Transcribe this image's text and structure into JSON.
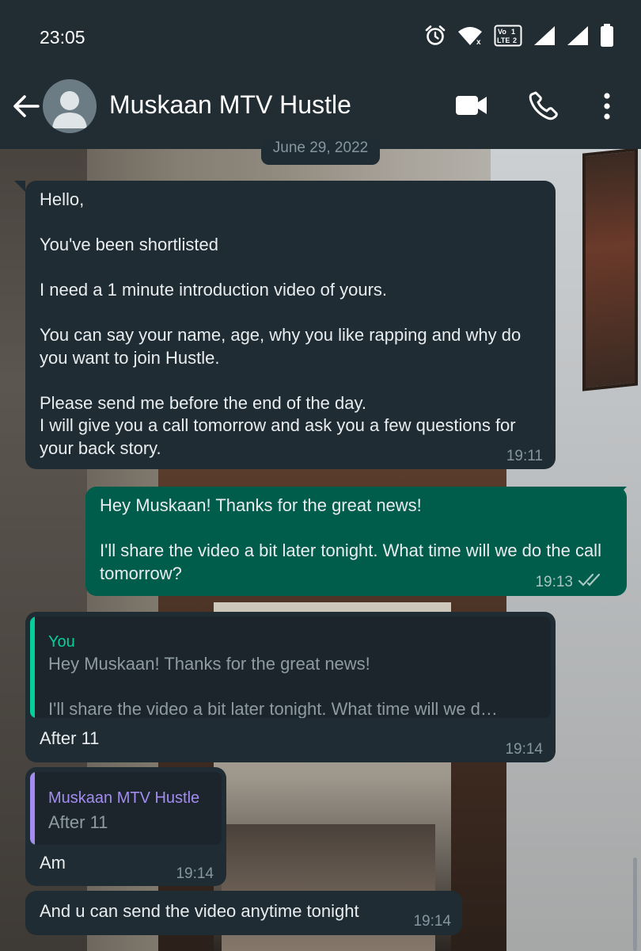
{
  "status_bar": {
    "time": "23:05",
    "icons": [
      "alarm-icon",
      "wifi-icon",
      "volte-lte-icon",
      "signal-1-icon",
      "signal-2-icon",
      "battery-icon"
    ],
    "volte_label_1": "Vo",
    "volte_label_2": "LTE"
  },
  "header": {
    "contact_name": "Muskaan MTV Hustle",
    "icons": [
      "back-arrow-icon",
      "avatar-placeholder-icon",
      "video-call-icon",
      "voice-call-icon",
      "more-vert-icon"
    ]
  },
  "date_chip": "June 29, 2022",
  "messages": [
    {
      "direction": "incoming",
      "text": "Hello,\n\nYou've been shortlisted\n\nI need a 1 minute introduction video of yours.\n\nYou can say your name, age, why you like rapping and why do you want to join Hustle.\n\nPlease send me before the end of the day.\nI will give you a call tomorrow and ask you a few questions for your back story.",
      "time": "19:11"
    },
    {
      "direction": "outgoing",
      "text": "Hey Muskaan! Thanks for the great news!\n\nI'll share the video a bit later tonight. What time will we do the call tomorrow?",
      "time": "19:13",
      "status": "read"
    },
    {
      "direction": "incoming",
      "quote": {
        "author": "You",
        "text": "Hey Muskaan! Thanks for the great news!\n\nI'll share the video a bit later tonight. What time will we d…"
      },
      "text": "After 11",
      "time": "19:14"
    },
    {
      "direction": "incoming",
      "quote": {
        "author": "Muskaan MTV Hustle",
        "text": "After 11"
      },
      "text": "Am",
      "time": "19:14"
    },
    {
      "direction": "incoming",
      "text": "And u can send the video anytime tonight",
      "time": "19:14"
    }
  ],
  "colors": {
    "header_bg": "#212c33",
    "incoming_bubble": "#1f2c33",
    "outgoing_bubble": "#005c4b",
    "quote_you_accent": "#06cf9c",
    "quote_contact_accent": "#a38cf0",
    "read_ticks": "#a9c7c0",
    "timestamp": "#8696a0"
  }
}
